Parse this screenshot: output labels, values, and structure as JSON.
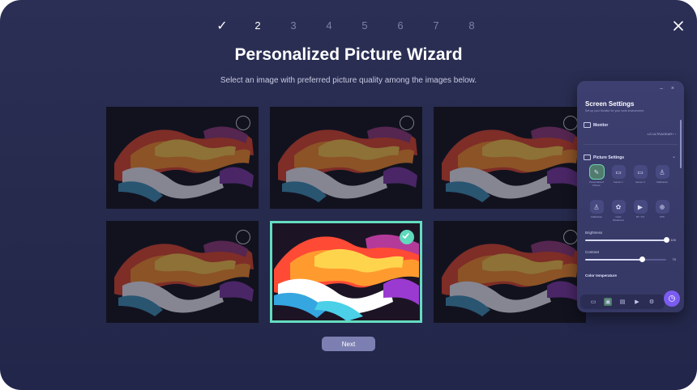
{
  "wizard": {
    "steps": [
      {
        "label": "✓",
        "state": "done"
      },
      {
        "label": "2",
        "state": "active"
      },
      {
        "label": "3",
        "state": "upcoming"
      },
      {
        "label": "4",
        "state": "upcoming"
      },
      {
        "label": "5",
        "state": "upcoming"
      },
      {
        "label": "6",
        "state": "upcoming"
      },
      {
        "label": "7",
        "state": "upcoming"
      },
      {
        "label": "8",
        "state": "upcoming"
      }
    ],
    "title": "Personalized Picture Wizard",
    "subtitle": "Select an image with preferred picture quality among the images below.",
    "close_icon": "close-icon",
    "images": [
      {
        "selected": false
      },
      {
        "selected": false
      },
      {
        "selected": false
      },
      {
        "selected": false
      },
      {
        "selected": true
      },
      {
        "selected": false
      }
    ],
    "next_label": "Next",
    "accent_color": "#64dcc0"
  },
  "panel": {
    "window_controls": "– ×",
    "title": "Screen Settings",
    "subtitle": "Set up your Monitor for your work environment.",
    "monitor": {
      "label": "Monitor",
      "icon": "monitor-icon",
      "value": "LG ULTRAGEAR+",
      "chevron": "›"
    },
    "picture_settings": {
      "label": "Picture Settings",
      "icon": "picture-icon",
      "chevron": "⌄"
    },
    "modes": [
      {
        "icon": "wizard-icon",
        "glyph": "✎",
        "label": "Personalized Picture",
        "selected": true
      },
      {
        "icon": "gamer1-icon",
        "glyph": "▭",
        "label": "Gamer 1",
        "selected": false
      },
      {
        "icon": "gamer2-icon",
        "glyph": "▭",
        "label": "Gamer 2",
        "selected": false
      },
      {
        "icon": "calibration-icon",
        "glyph": "♙",
        "label": "Calibration",
        "selected": false
      },
      {
        "icon": "calibration2-icon",
        "glyph": "♙",
        "label": "Calibration",
        "selected": false
      },
      {
        "icon": "color-weakness-icon",
        "glyph": "✿",
        "label": "Color Weakness",
        "selected": false
      },
      {
        "icon": "rts-icon",
        "glyph": "▶",
        "label": "RT / FS",
        "selected": false
      },
      {
        "icon": "fps-icon",
        "glyph": "⊕",
        "label": "FPS",
        "selected": false
      }
    ],
    "brightness": {
      "label": "Brightness",
      "value": 100,
      "display": "100"
    },
    "contrast": {
      "label": "Contrast",
      "value": 70,
      "display": "70"
    },
    "color_temperature": {
      "label": "Color temperature"
    },
    "taskbar": [
      {
        "icon": "display-icon",
        "glyph": "▭"
      },
      {
        "icon": "picture-mode-icon",
        "glyph": "▣"
      },
      {
        "icon": "screen-split-icon",
        "glyph": "▤"
      },
      {
        "icon": "media-icon",
        "glyph": "▶"
      },
      {
        "icon": "settings-icon",
        "glyph": "⚙"
      }
    ],
    "fab_glyph": "◷"
  }
}
